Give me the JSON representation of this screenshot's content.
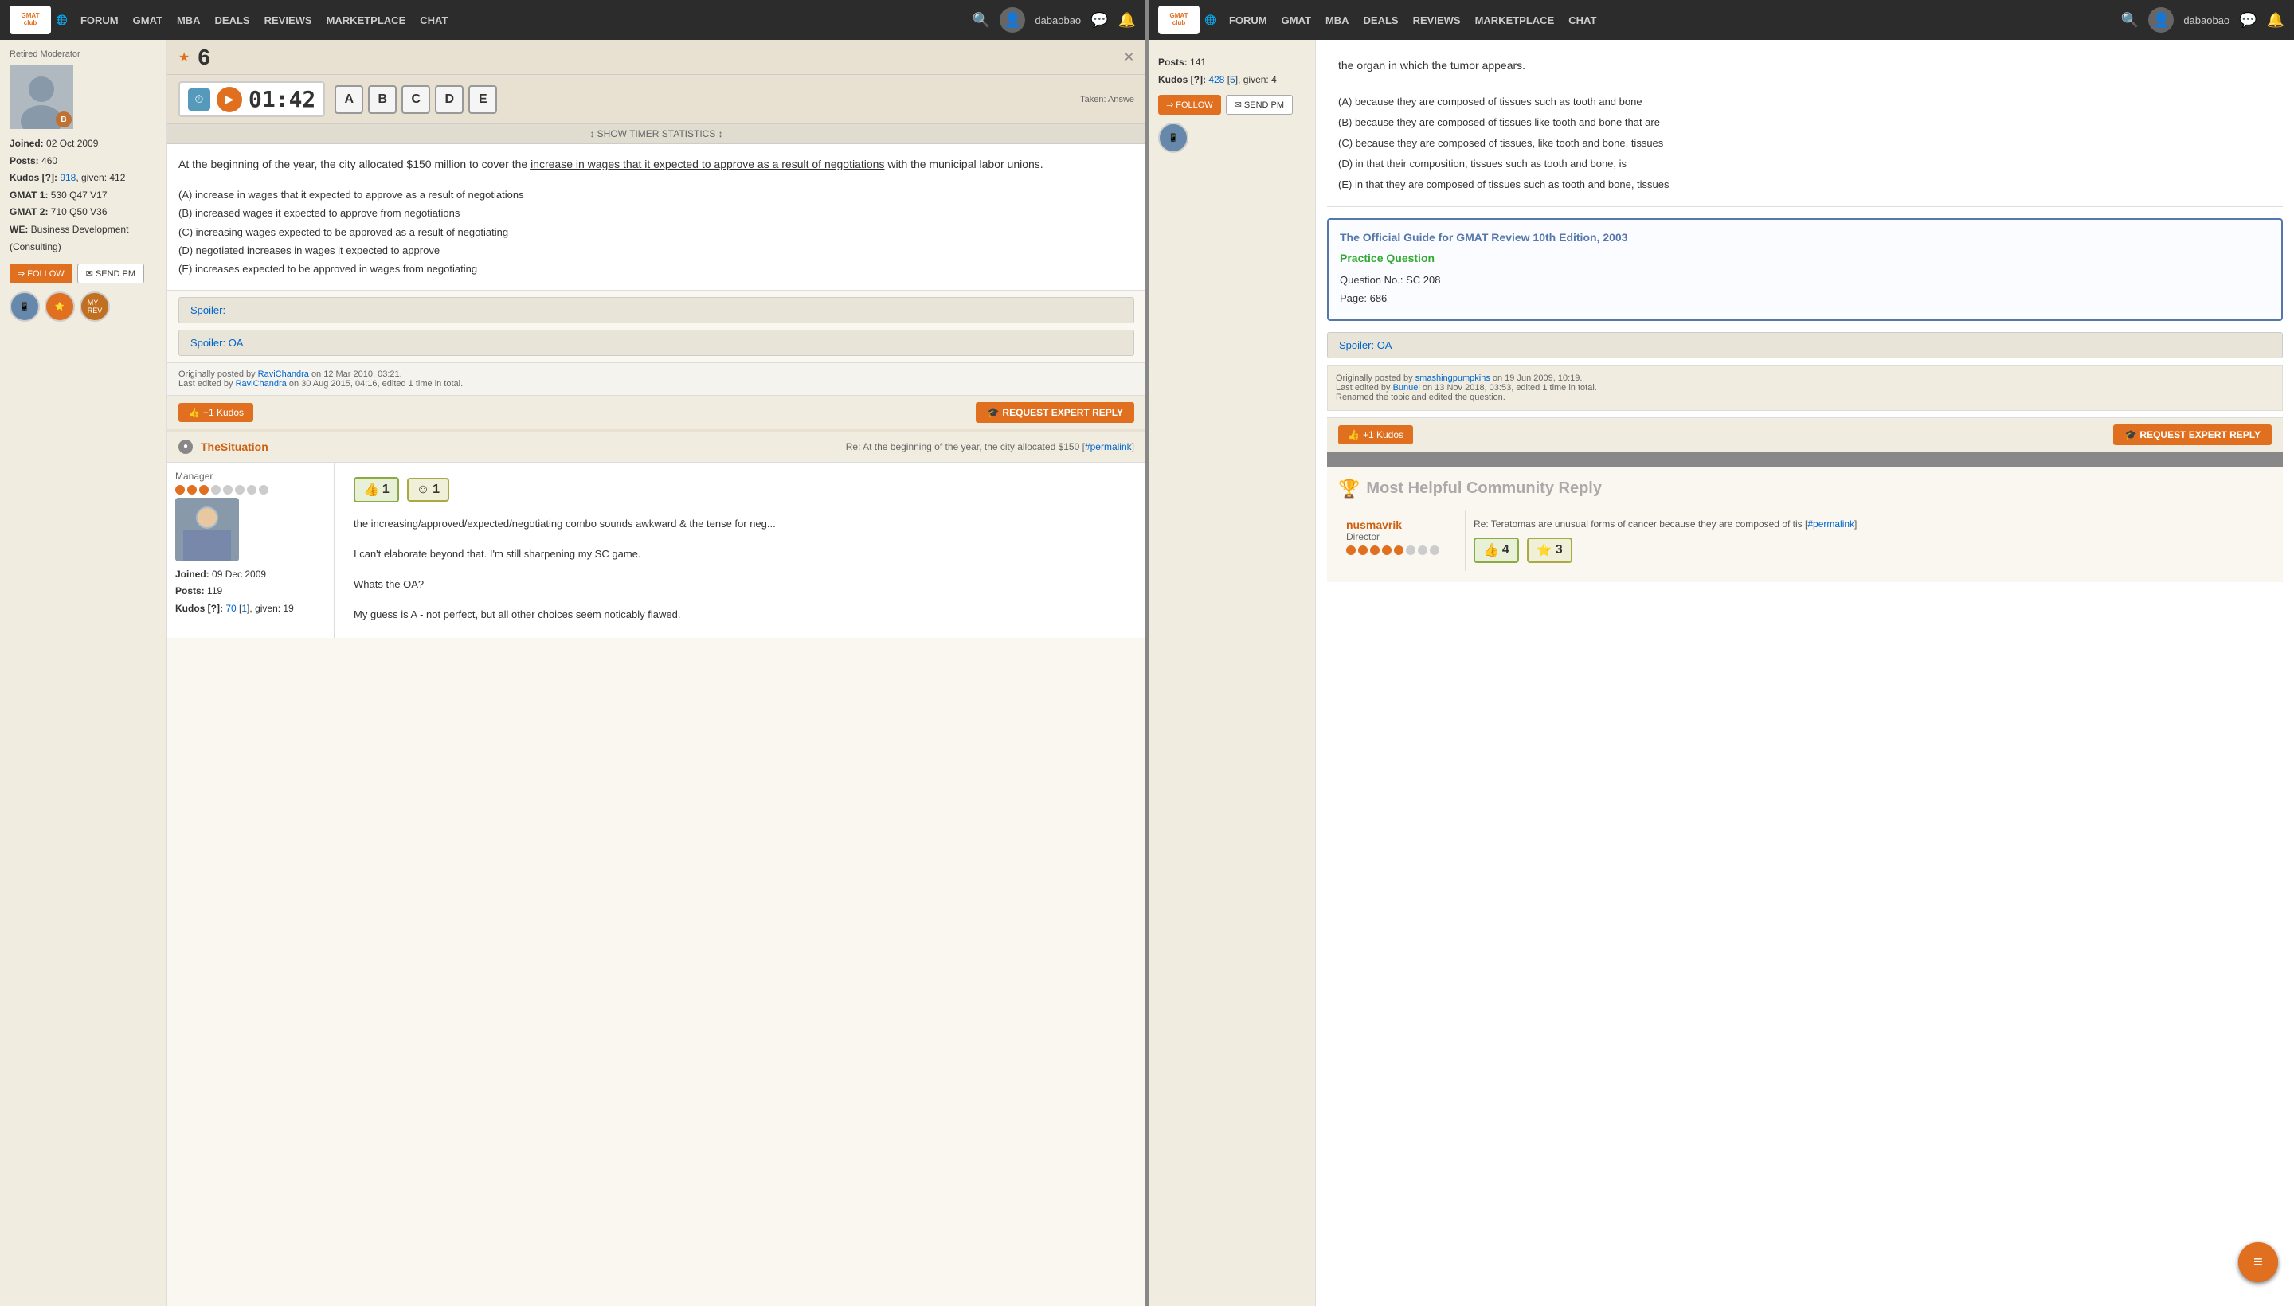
{
  "nav": {
    "logo_text": "GMAT\nclub",
    "links": [
      "FORUM",
      "GMAT",
      "MBA",
      "DEALS",
      "REVIEWS",
      "MARKETPLACE",
      "CHAT"
    ],
    "user": "dabaobao",
    "search_placeholder": "Search"
  },
  "left_panel": {
    "nav_links": [
      "FORUM",
      "GMAT",
      "MBA",
      "DEALS",
      "REVIEWS",
      "MARKETPLACE",
      "CHAT"
    ],
    "user_left": "dabaobao",
    "sidebar": {
      "role": "Retired Moderator",
      "avatar_badge": "B",
      "joined": "02 Oct 2009",
      "posts": "460",
      "kudos_label": "Kudos",
      "kudos_value": "918",
      "kudos_given": "given: 412",
      "gmat1": "530 Q47 V17",
      "gmat2": "710 Q50 V36",
      "we": "Business Development (Consulting)",
      "follow_btn": "FOLLOW",
      "pm_btn": "SEND PM"
    },
    "question": {
      "difficulty": "6",
      "timer_time": "01:42",
      "answers": [
        "A",
        "B",
        "C",
        "D",
        "E"
      ],
      "taken_label": "Taken:\nAnswe",
      "show_timer": "SHOW TIMER STATISTICS",
      "body": "At the beginning of the year, the city allocated $150 million to cover the increase in wages that it expected to approve as a result of negotiations with the municipal labor unions.",
      "choices": [
        "(A) increase in wages that it expected to approve as a result of negotiations",
        "(B) increased wages it expected to approve from negotiations",
        "(C) increasing wages expected to be approved as a result of negotiating",
        "(D) negotiated increases in wages it expected to approve",
        "(E) increases expected to be approved in wages from negotiating"
      ],
      "spoiler1_label": "Spoiler:",
      "spoiler2_label": "Spoiler: OA",
      "originally_posted_by": "Originally posted by",
      "poster1": "RaviChandra",
      "post_date1": "on 12 Mar 2010, 03:21.",
      "last_edited_by": "Last edited by",
      "editor1": "RaviChandra",
      "edit_date1": "on 30 Aug 2015, 04:16, edited 1 time in total.",
      "kudos_count": "+1 Kudos",
      "expert_reply_btn": "REQUEST EXPERT REPLY"
    },
    "reply": {
      "user": "TheSituation",
      "role": "Manager",
      "dots_filled": 3,
      "dots_empty": 5,
      "joined": "09 Dec 2009",
      "posts": "119",
      "kudos_value": "70",
      "kudos_link": "1",
      "kudos_given": "given: 19",
      "permalink_label": "#permalink",
      "reply_subject": "Re: At the beginning of the year, the city allocated $150",
      "reaction1_count": "1",
      "reaction2_count": "1",
      "reply_text1": "the increasing/approved/expected/negotiating combo sounds awkward & the tense for neg...",
      "reply_text2": "I can't elaborate beyond that. I'm still sharpening my SC game.",
      "reply_text3": "Whats the OA?",
      "reply_text4": "My guess is A - not perfect, but all other choices seem noticably flawed.",
      "scroll_icon": "≡"
    }
  },
  "right_panel": {
    "nav_links": [
      "FORUM",
      "GMAT",
      "MBA",
      "DEALS",
      "REVIEWS",
      "MARKETPLACE",
      "CHAT"
    ],
    "user_right": "dabaobao",
    "sidebar_right": {
      "posts": "141",
      "kudos_value": "428",
      "kudos_link": "5",
      "kudos_given": "given: 4",
      "follow_btn": "FOLLOW",
      "pm_btn": "SEND PM"
    },
    "question_right": {
      "intro": "the organ in which the tumor appears.",
      "choices": [
        "(A) because they are composed of tissues such as tooth and bone",
        "(B) because they are composed of tissues like tooth and bone that are",
        "(C) because they are composed of tissues, like tooth and bone, tissues",
        "(D) in that their composition, tissues such as tooth and bone, is",
        "(E) in that they are composed of tissues such as tooth and bone, tissues"
      ],
      "guide_title": "The Official Guide for GMAT Review 10th Edition, 2003",
      "practice_label": "Practice Question",
      "question_no": "Question No.: SC 208",
      "page": "Page: 686",
      "spoiler_oa": "Spoiler: OA",
      "originally_posted_by": "Originally posted by",
      "poster2": "smashingpumpkins",
      "post_date2": "on 19 Jun 2009, 10:19.",
      "last_edited_by": "Last edited by",
      "editor2": "Bunuel",
      "edit_date2": "on 13 Nov 2018, 03:53, edited 1 time in total.",
      "renamed_note": "Renamed the topic and edited the question.",
      "kudos_count": "+1 Kudos",
      "expert_reply_btn": "REQUEST EXPERT REPLY"
    },
    "most_helpful": {
      "title": "Most Helpful Community Reply",
      "user": "nusmavrik",
      "role": "Director",
      "dots_filled": 5,
      "dots_empty": 3,
      "reply_subject": "Re: Teratomas are unusual forms of cancer because they are composed of tis",
      "permalink_label": "#permalink",
      "reaction1_count": "4",
      "reaction2_count": "3"
    }
  }
}
